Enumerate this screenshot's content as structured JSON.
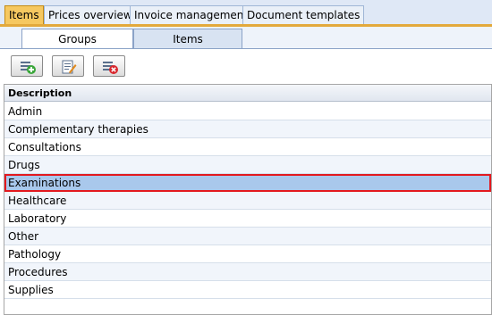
{
  "top_tabs": [
    {
      "label": "Items",
      "active": true
    },
    {
      "label": "Prices overview",
      "active": false
    },
    {
      "label": "Invoice management",
      "active": false
    },
    {
      "label": "Document templates",
      "active": false
    }
  ],
  "sub_tabs": [
    {
      "label": "Groups",
      "active": true
    },
    {
      "label": "Items",
      "active": false
    }
  ],
  "toolbar": {
    "add_icon": "add-group-icon",
    "edit_icon": "edit-group-icon",
    "delete_icon": "delete-group-icon"
  },
  "grid": {
    "header": "Description",
    "rows": [
      "Admin",
      "Complementary therapies",
      "Consultations",
      "Drugs",
      "Examinations",
      "Healthcare",
      "Laboratory",
      "Other",
      "Pathology",
      "Procedures",
      "Supplies"
    ],
    "selected_row": "Examinations"
  },
  "colors": {
    "active_tab": "#f6c860",
    "selected_row": "#a9c8ec",
    "selection_border": "#e3191f"
  }
}
